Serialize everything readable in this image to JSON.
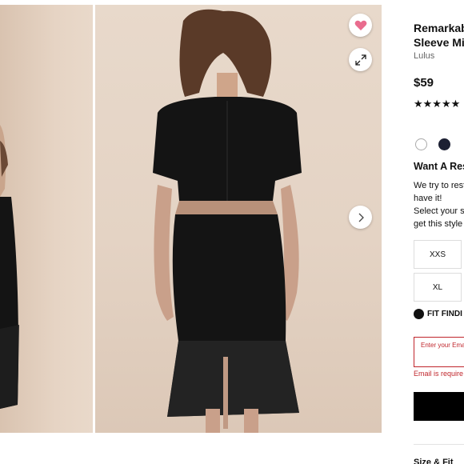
{
  "product": {
    "title_line1": "Remarkab",
    "title_line2": "Sleeve Mi",
    "brand": "Lulus",
    "price": "$59",
    "stars": "★★★★★"
  },
  "colors": {
    "swatch_white": "#ffffff",
    "swatch_navy": "#1d2033",
    "heart": "#e96c8e",
    "error": "#c0262c"
  },
  "restock": {
    "heading": "Want A Res",
    "line1": "We try to rest",
    "line2": "have it!",
    "line3": "Select your s",
    "line4": "get this style"
  },
  "sizes": [
    "XXS",
    "XL"
  ],
  "fit_finder": {
    "label": "FIT FINDI"
  },
  "email": {
    "placeholder": "Enter your Emai",
    "error": "Email is require"
  },
  "section": {
    "size_fit": "Size & Fit"
  },
  "icons": {
    "favorite": "heart-icon",
    "zoom": "expand-icon",
    "next": "chevron-right-icon"
  }
}
